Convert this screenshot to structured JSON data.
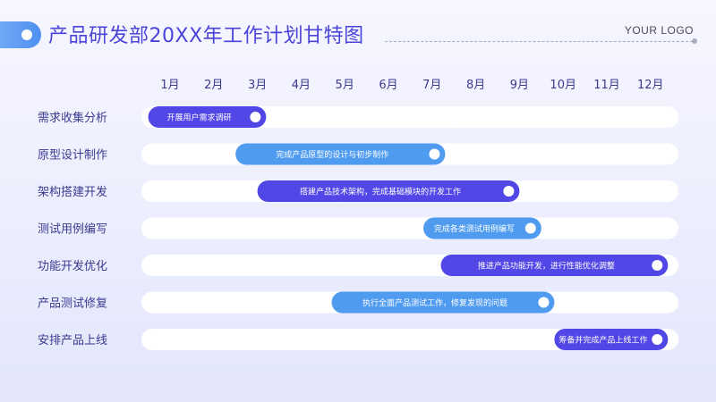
{
  "header": {
    "title": "产品研发部20XX年工作计划甘特图",
    "logo": "YOUR LOGO"
  },
  "colors": {
    "purple": "#5146e6",
    "blue": "#4f9bf0",
    "track": "#ffffff",
    "title": "#4a44d8"
  },
  "chart_data": {
    "type": "gantt",
    "categories": [
      "1月",
      "2月",
      "3月",
      "4月",
      "5月",
      "6月",
      "7月",
      "8月",
      "9月",
      "10月",
      "11月",
      "12月"
    ],
    "tasks": [
      {
        "name": "需求收集分析",
        "label": "开展用户需求调研",
        "start": 0.5,
        "end": 3.2,
        "color": "purple"
      },
      {
        "name": "原型设计制作",
        "label": "完成产品原型的设计与初步制作",
        "start": 2.5,
        "end": 7.3,
        "color": "blue"
      },
      {
        "name": "架构搭建开发",
        "label": "搭建产品技术架构，完成基础模块的开发工作",
        "start": 3.0,
        "end": 9.0,
        "color": "purple"
      },
      {
        "name": "测试用例编写",
        "label": "完成各类测试用例编写",
        "start": 6.8,
        "end": 9.5,
        "color": "blue"
      },
      {
        "name": "功能开发优化",
        "label": "推进产品功能开发，进行性能优化调整",
        "start": 7.2,
        "end": 12.4,
        "color": "purple"
      },
      {
        "name": "产品测试修复",
        "label": "执行全面产品测试工作，修复发现的问题",
        "start": 4.7,
        "end": 9.8,
        "color": "blue"
      },
      {
        "name": "安排产品上线",
        "label": "筹备并完成产品上线工作",
        "start": 9.8,
        "end": 12.4,
        "color": "purple"
      }
    ]
  }
}
